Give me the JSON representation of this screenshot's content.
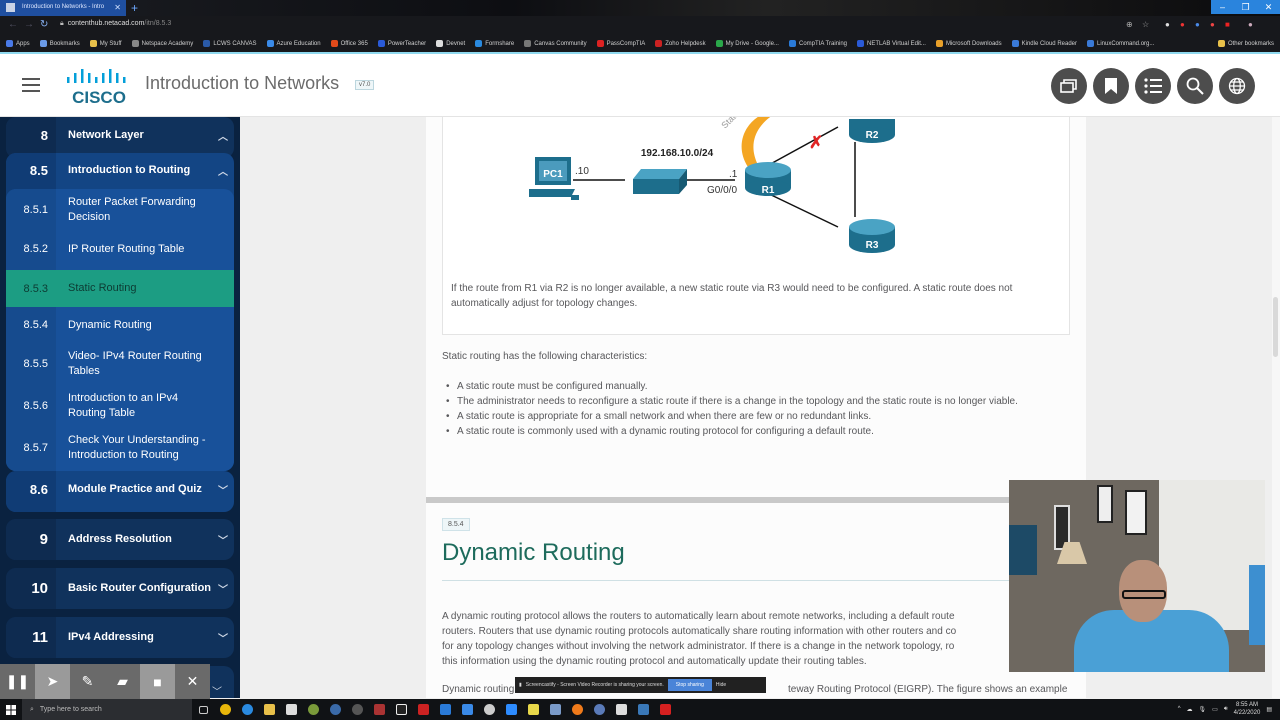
{
  "browser": {
    "tab_title": "Introduction to Networks - Intro",
    "url_host": "contenthub.netacad.com",
    "url_path": "/itn/8.5.3",
    "bookmarks": [
      "Apps",
      "Bookmarks",
      "My Stuff",
      "Netspace Academy",
      "LCWS CANVAS",
      "Azure Education",
      "Office 365",
      "PowerTeacher",
      "Devnet",
      "Formshare",
      "Canvas Community",
      "PassCompTIA",
      "Zoho Helpdesk",
      "My Drive - Google...",
      "CompTIA Training",
      "NETLAB Virtual Edit...",
      "Microsoft Downloads",
      "Kindle Cloud Reader",
      "LinuxCommand.org..."
    ],
    "other_bookmarks": "Other bookmarks"
  },
  "header": {
    "logo_text": "CISCO",
    "title": "Introduction to Networks",
    "version": "v7.0",
    "icons": [
      "resources-icon",
      "bookmark-icon",
      "list-icon",
      "search-icon",
      "globe-icon"
    ]
  },
  "sidebar": {
    "chapter_current": {
      "num": "8",
      "label": "Network Layer"
    },
    "section_current": {
      "num": "8.5",
      "label": "Introduction to Routing"
    },
    "subsections": [
      {
        "num": "8.5.1",
        "label": "Router Packet Forwarding Decision"
      },
      {
        "num": "8.5.2",
        "label": "IP Router Routing Table"
      },
      {
        "num": "8.5.3",
        "label": "Static Routing",
        "active": true
      },
      {
        "num": "8.5.4",
        "label": "Dynamic Routing"
      },
      {
        "num": "8.5.5",
        "label": "Video- IPv4 Router Routing Tables"
      },
      {
        "num": "8.5.6",
        "label": "Introduction to an IPv4 Routing Table"
      },
      {
        "num": "8.5.7",
        "label": "Check Your Understanding - Introduction to Routing"
      }
    ],
    "section_next": {
      "num": "8.6",
      "label": "Module Practice and Quiz"
    },
    "chapters": [
      {
        "num": "9",
        "label": "Address Resolution"
      },
      {
        "num": "10",
        "label": "Basic Router Configuration"
      },
      {
        "num": "11",
        "label": "IPv4 Addressing"
      }
    ]
  },
  "figure": {
    "network": "192.168.10.0/24",
    "pc_label": "PC1",
    "pc_host": ".10",
    "r1_host": ".1",
    "r1_iface": "G0/0/0",
    "routers": [
      "R1",
      "R2",
      "R3"
    ],
    "static_label": "Static",
    "caption": "If the route from R1 via R2 is no longer available, a new static route via R3 would need to be configured. A static route does not automatically adjust for topology changes."
  },
  "content": {
    "intro": "Static routing has the following characteristics:",
    "bullets": [
      "A static route must be configured manually.",
      "The administrator needs to reconfigure a static route if there is a change in the topology and the static route is no longer viable.",
      "A static route is appropriate for a small network and when there are few or no redundant links.",
      "A static route is commonly used with a dynamic routing protocol for configuring a default route."
    ],
    "next_badge": "8.5.4",
    "next_title": "Dynamic Routing",
    "dyn_lines": [
      "A dynamic routing protocol allows the routers to automatically learn about remote networks, including a default route",
      "routers. Routers that use dynamic routing protocols automatically share routing information with other routers and co",
      "for any topology changes without involving the network administrator. If there is a change in the network topology, ro",
      "this information using the dynamic routing protocol and automatically update their routing tables."
    ],
    "last_line_start": "Dynamic routing",
    "last_line_end": "teway Routing Protocol (EIGRP). The figure shows an example"
  },
  "overlays": {
    "share_text": "Screencastify - Screen Video Recorder is sharing your screen.",
    "stop_sharing": "Stop sharing",
    "hide": "Hide"
  },
  "taskbar": {
    "search_placeholder": "Type here to search",
    "time": "8:55 AM",
    "date": "4/22/2020"
  }
}
